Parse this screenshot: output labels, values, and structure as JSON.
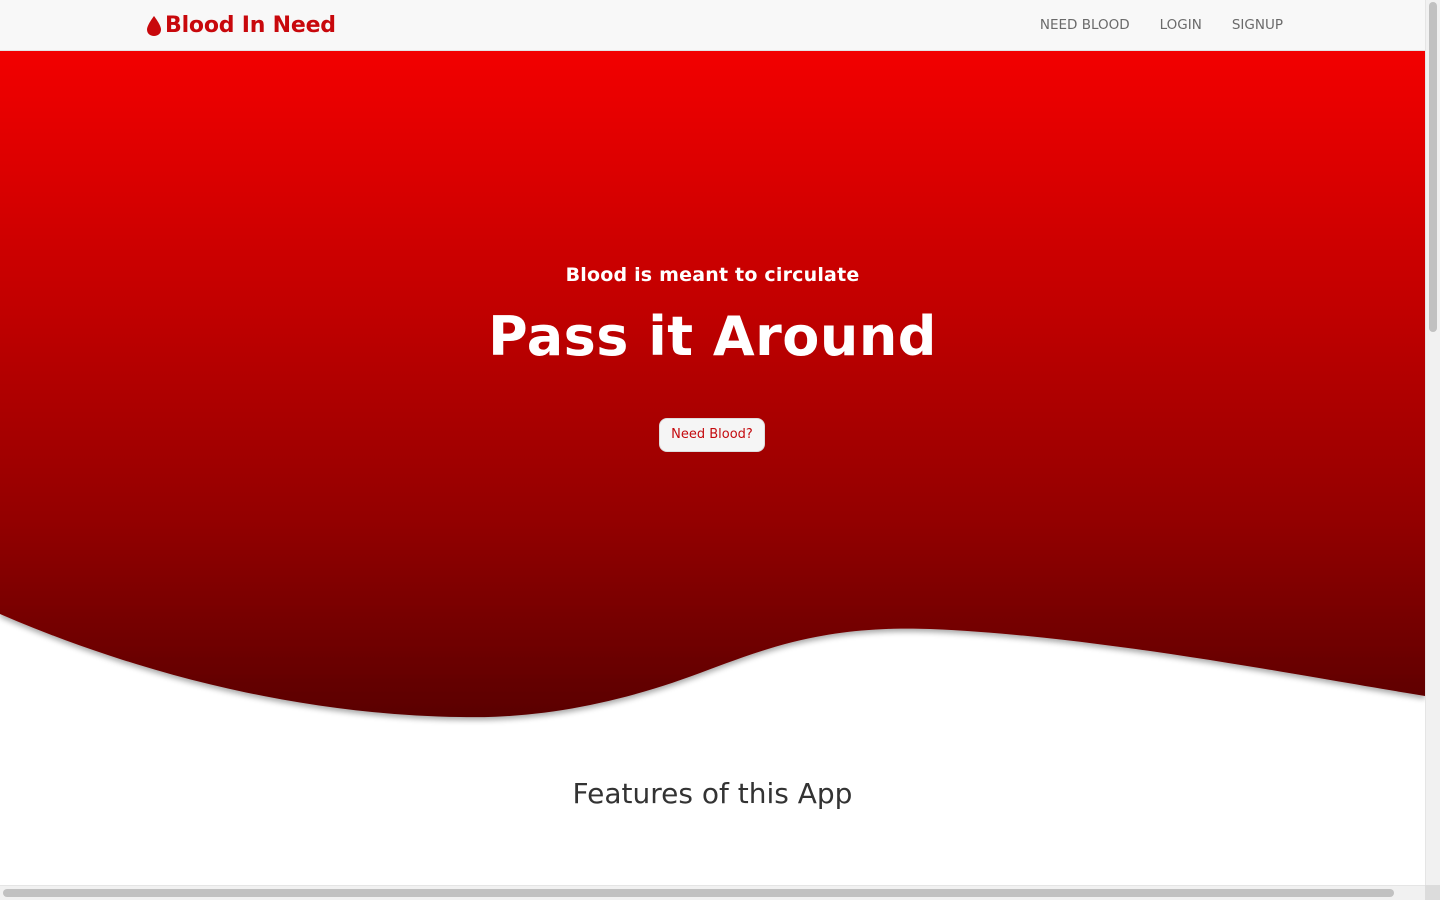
{
  "navbar": {
    "brand_text": "Blood In Need",
    "brand_icon": "blood-drop-icon",
    "links": [
      {
        "label": "NEED BLOOD"
      },
      {
        "label": "LOGIN"
      },
      {
        "label": "SIGNUP"
      }
    ]
  },
  "hero": {
    "subtitle": "Blood is meant to circulate",
    "title": "Pass it Around",
    "button_label": "Need Blood?"
  },
  "features": {
    "heading": "Features of this App"
  },
  "colors": {
    "brand": "#c8080c",
    "hero_top": "#f20000",
    "hero_bottom": "#5e0000",
    "navbar_bg": "#f8f8f8",
    "nav_link": "#6a6a6a"
  }
}
